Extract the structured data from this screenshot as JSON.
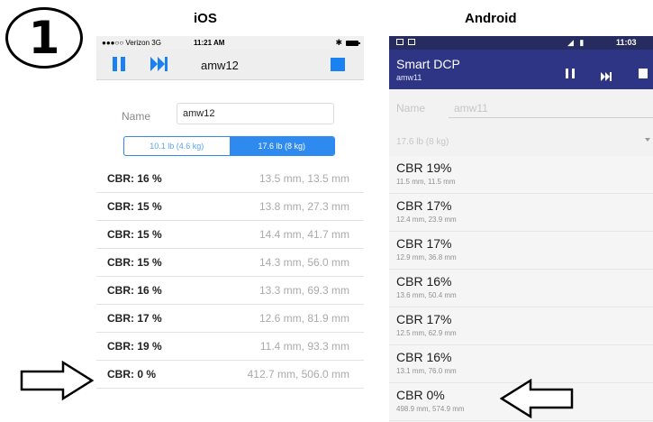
{
  "step_number": "1",
  "labels": {
    "ios": "iOS",
    "android": "Android"
  },
  "ios": {
    "status": {
      "carrier": "●●●○○ Verizon  3G",
      "time": "11:21 AM",
      "bluetooth": "✱"
    },
    "toolbar": {
      "title": "amw12",
      "pause_icon": "pause-icon",
      "skip_icon": "skip-forward-icon",
      "stop_icon": "stop-icon"
    },
    "name_label": "Name",
    "name_value": "amw12",
    "weight_segments": [
      "10.1 lb (4.6 kg)",
      "17.6 lb (8 kg)"
    ],
    "weight_selected_index": 1,
    "rows": [
      {
        "cbr": "CBR: 16 %",
        "mm": "13.5 mm, 13.5 mm"
      },
      {
        "cbr": "CBR: 15 %",
        "mm": "13.8 mm, 27.3 mm"
      },
      {
        "cbr": "CBR: 15 %",
        "mm": "14.4 mm, 41.7 mm"
      },
      {
        "cbr": "CBR: 15 %",
        "mm": "14.3 mm, 56.0 mm"
      },
      {
        "cbr": "CBR: 16 %",
        "mm": "13.3 mm, 69.3 mm"
      },
      {
        "cbr": "CBR: 17 %",
        "mm": "12.6 mm, 81.9 mm"
      },
      {
        "cbr": "CBR: 19 %",
        "mm": "11.4 mm, 93.3 mm"
      },
      {
        "cbr": "CBR: 0 %",
        "mm": "412.7 mm, 506.0 mm"
      }
    ],
    "accent_color": "#1a82f0"
  },
  "android": {
    "status": {
      "time": "11:03",
      "signal": "◢ ▮"
    },
    "toolbar": {
      "title": "Smart DCP",
      "subtitle": "amw11",
      "pause_icon": "pause-icon",
      "skip_icon": "skip-forward-icon",
      "stop_icon": "stop-icon"
    },
    "name_label": "Name",
    "name_value": "amw11",
    "weight_value": "17.6 lb (8 kg)",
    "items": [
      {
        "cbr": "CBR 19%",
        "mm": "11.5 mm, 11.5 mm"
      },
      {
        "cbr": "CBR 17%",
        "mm": "12.4 mm, 23.9 mm"
      },
      {
        "cbr": "CBR 17%",
        "mm": "12.9 mm, 36.8 mm"
      },
      {
        "cbr": "CBR 16%",
        "mm": "13.6 mm, 50.4 mm"
      },
      {
        "cbr": "CBR 17%",
        "mm": "12.5 mm, 62.9 mm"
      },
      {
        "cbr": "CBR 16%",
        "mm": "13.1 mm, 76.0 mm"
      },
      {
        "cbr": "CBR 0%",
        "mm": "498.9 mm, 574.9 mm"
      }
    ],
    "toolbar_color": "#2d3584",
    "status_color": "#262b60"
  },
  "annotations": {
    "left_arrow_icon": "arrow-right-outline-icon",
    "right_arrow_icon": "arrow-left-outline-icon"
  }
}
